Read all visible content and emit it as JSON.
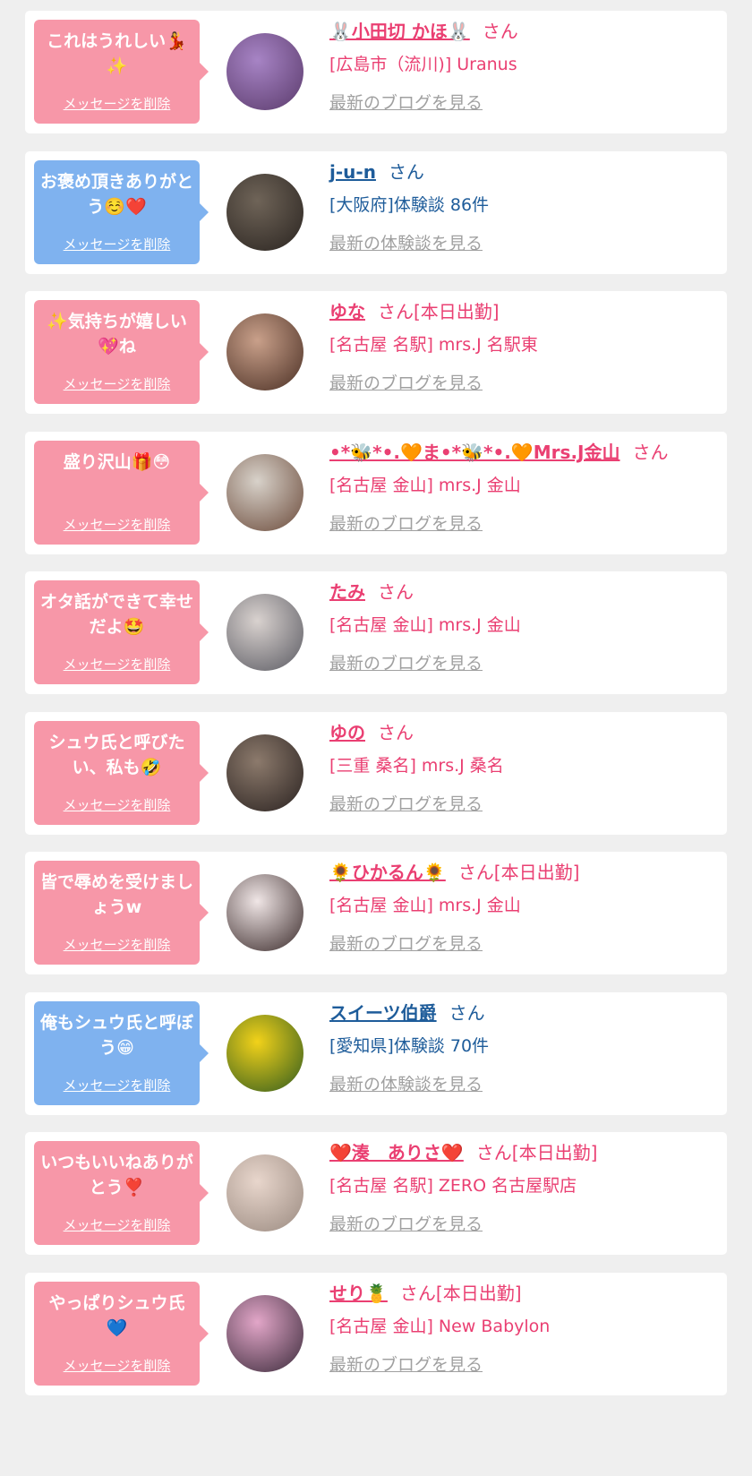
{
  "delete_label": "メッセージを削除",
  "colors": {
    "pink_bubble": "#f797a8",
    "blue_bubble": "#7fb2ef",
    "pink_text": "#ea3f72",
    "blue_text": "#1e5c9a",
    "link_gray": "#a0a0a0"
  },
  "items": [
    {
      "theme": "pink",
      "message": "これはうれしい💃✨",
      "name": "🐰小田切 かほ🐰",
      "suffix": "さん",
      "shop": "[広島市（流川)] Uranus",
      "latest_link": "最新のブログを見る",
      "avatar": [
        "#a784c5",
        "#5a3a6b"
      ]
    },
    {
      "theme": "blue",
      "message": "お褒め頂きありがとう☺️❤️",
      "name": "j-u-n",
      "suffix": "さん",
      "shop": "[大阪府]体験談 86件",
      "latest_link": "最新の体験談を見る",
      "avatar": [
        "#6f6458",
        "#2a2420"
      ]
    },
    {
      "theme": "pink",
      "message": "✨気持ちが嬉しい💖ね",
      "name": "ゆな",
      "suffix": "さん[本日出勤]",
      "shop": "[名古屋 名駅] mrs.J 名駅東",
      "latest_link": "最新のブログを見る",
      "avatar": [
        "#c9a08a",
        "#4a2f24"
      ]
    },
    {
      "theme": "pink",
      "message": "盛り沢山🎁😳",
      "name": "•*🐝*•.🧡ま•*🐝*•.🧡Mrs.J金山",
      "suffix": "さん",
      "shop": "[名古屋 金山] mrs.J 金山",
      "latest_link": "最新のブログを見る",
      "avatar": [
        "#d8d2ca",
        "#6b4a3a"
      ]
    },
    {
      "theme": "pink",
      "message": "オタ話ができて幸せだよ🤩",
      "name": "たみ",
      "suffix": "さん",
      "shop": "[名古屋 金山] mrs.J 金山",
      "latest_link": "最新のブログを見る",
      "avatar": [
        "#d9d2cf",
        "#5a5a62"
      ]
    },
    {
      "theme": "pink",
      "message": "シュウ氏と呼びたい、私も🤣",
      "name": "ゆの",
      "suffix": "さん",
      "shop": "[三重 桑名] mrs.J 桑名",
      "latest_link": "最新のブログを見る",
      "avatar": [
        "#8c7a6c",
        "#2a2220"
      ]
    },
    {
      "theme": "pink",
      "message": "皆で辱めを受けましょうw",
      "name": "🌻ひかるん🌻",
      "suffix": "さん[本日出勤]",
      "shop": "[名古屋 金山] mrs.J 金山",
      "latest_link": "最新のブログを見る",
      "avatar": [
        "#f0e6e6",
        "#3a2a2a"
      ]
    },
    {
      "theme": "blue",
      "message": "俺もシュウ氏と呼ぼう😁",
      "name": "スイーツ伯爵",
      "suffix": "さん",
      "shop": "[愛知県]体験談 70件",
      "latest_link": "最新の体験談を見る",
      "avatar": [
        "#f2d21a",
        "#2f5a1e"
      ]
    },
    {
      "theme": "pink",
      "message": "いつもいいねありがとう❣️",
      "name": "❤️湊　ありさ❤️",
      "suffix": "さん[本日出勤]",
      "shop": "[名古屋 名駅] ZERO 名古屋駅店",
      "latest_link": "最新のブログを見る",
      "avatar": [
        "#e8d6cc",
        "#9a8a80"
      ]
    },
    {
      "theme": "pink",
      "message": "やっぱりシュウ氏💙",
      "name": "せり🍍",
      "suffix": "さん[本日出勤]",
      "shop": "[名古屋 金山] New Babylon",
      "latest_link": "最新のブログを見る",
      "avatar": [
        "#e2a6c8",
        "#3a2a3a"
      ]
    }
  ]
}
